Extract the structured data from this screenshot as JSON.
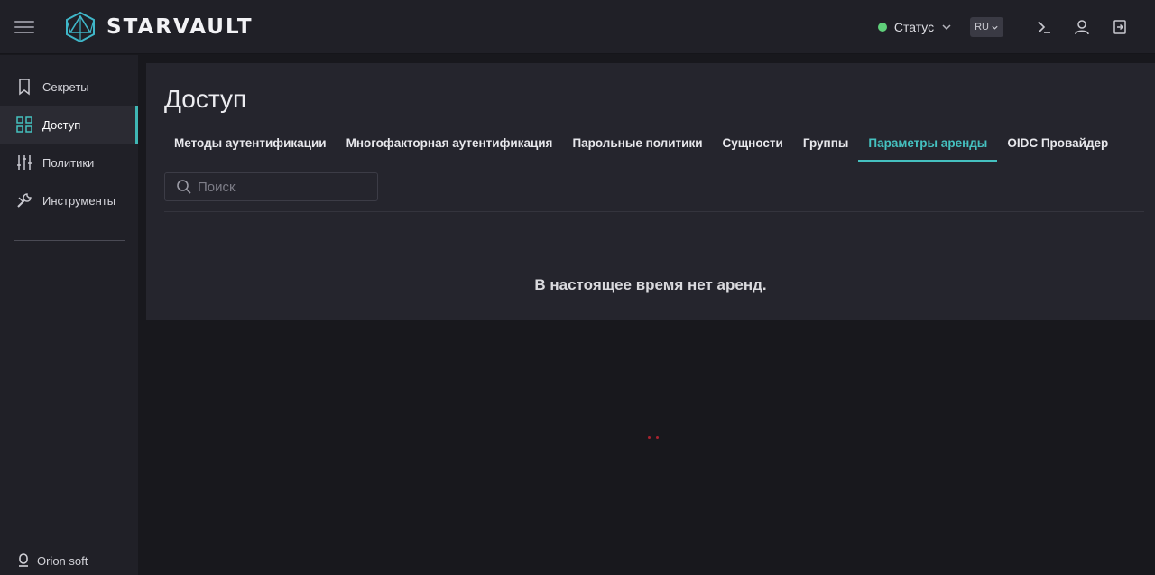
{
  "header": {
    "brand": "STARVAULT",
    "status_label": "Статус",
    "status_color": "#5fcf7a",
    "language": "RU",
    "icons": [
      "menu-icon",
      "terminal-icon",
      "user-icon",
      "logout-icon"
    ]
  },
  "sidebar": {
    "items": [
      {
        "label": "Секреты",
        "icon": "bookmark-icon"
      },
      {
        "label": "Доступ",
        "icon": "grid-icon"
      },
      {
        "label": "Политики",
        "icon": "sliders-icon"
      },
      {
        "label": "Инструменты",
        "icon": "wrench-icon"
      }
    ],
    "active_index": 1,
    "footer": "Orion soft"
  },
  "main": {
    "title": "Доступ",
    "tabs": [
      {
        "label": "Методы аутентификации"
      },
      {
        "label": "Многофакторная аутентификация"
      },
      {
        "label": "Парольные политики"
      },
      {
        "label": "Сущности"
      },
      {
        "label": "Группы"
      },
      {
        "label": "Параметры аренды"
      },
      {
        "label": "OIDC Провайдер"
      }
    ],
    "active_tab_index": 5,
    "search": {
      "placeholder": "Поиск",
      "value": ""
    },
    "empty_message": "В настоящее время нет аренд."
  },
  "colors": {
    "accent": "#45c1c0",
    "background": "#18181d",
    "surface": "#25252d"
  }
}
